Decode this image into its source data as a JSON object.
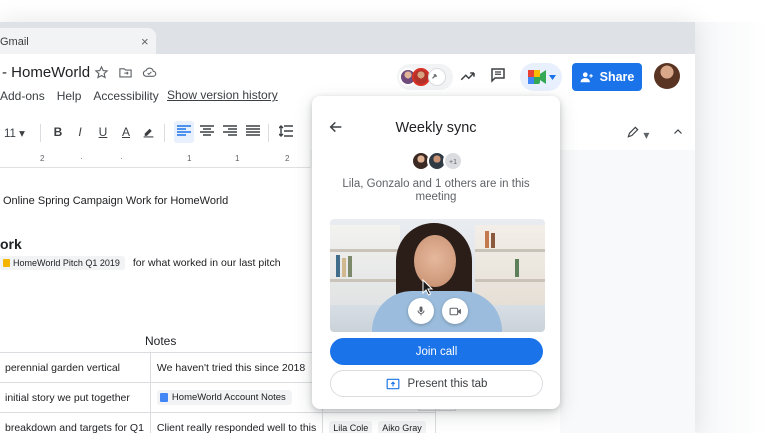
{
  "tab": {
    "title": "Gmail",
    "close": "×"
  },
  "doc": {
    "title": "- HomeWorld",
    "menus": [
      "Add-ons",
      "Help",
      "Accessibility"
    ],
    "version_link": "Show version history"
  },
  "header": {
    "share_label": "Share"
  },
  "toolbar": {
    "font_size": "11",
    "bold": "B",
    "italic": "I",
    "underline": "U",
    "text_color": "A"
  },
  "ruler": {
    "ticks": [
      "2",
      "1",
      "1",
      "2"
    ]
  },
  "body": {
    "line1": "Online Spring Campaign Work for HomeWorld",
    "heading": "ork",
    "chip_text": "HomeWorld Pitch Q1 2019",
    "chip_after": "for what worked in our last pitch",
    "notes_header": "Notes",
    "table": {
      "rows": [
        {
          "c1": "perennial garden vertical",
          "c2": "We haven't tried this since 2018"
        },
        {
          "c1": "initial story we put together",
          "c2": "HomeWorld Account Notes"
        },
        {
          "c1": "breakdown and targets for Q1",
          "c2": "Client really responded well to this",
          "people": [
            "Lila Cole",
            "Aiko Gray"
          ]
        }
      ],
      "plus_count": "0"
    }
  },
  "meet_popup": {
    "title": "Weekly sync",
    "plus_label": "+1",
    "description": "Lila, Gonzalo and 1 others are in this meeting",
    "join_label": "Join call",
    "present_label": "Present this tab"
  },
  "colors": {
    "accent": "#1a73e8",
    "tab_strip": "#dee1e6",
    "chip_bg": "#f1f3f4"
  }
}
